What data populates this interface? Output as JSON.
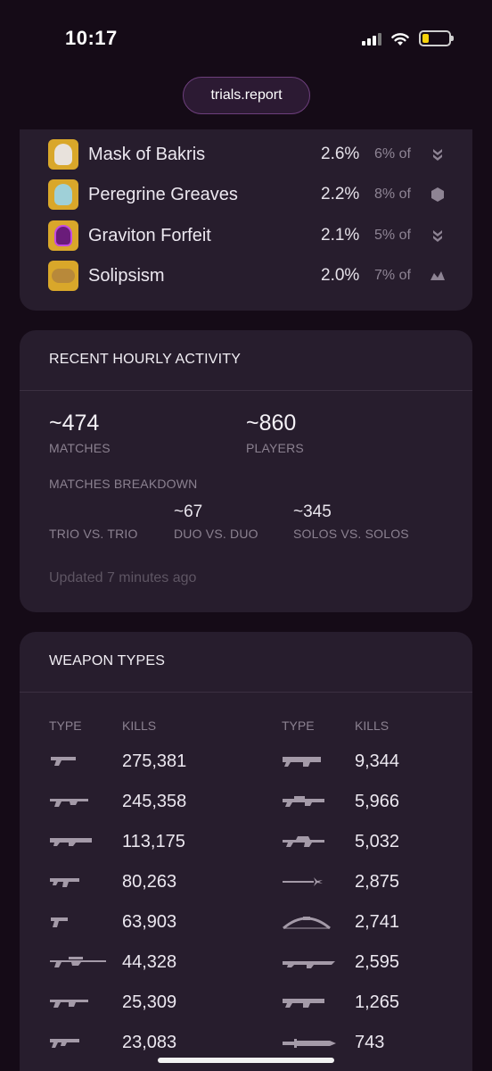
{
  "status_bar": {
    "time": "10:17"
  },
  "browser": {
    "url": "trials.report"
  },
  "armor": {
    "items": [
      {
        "name": "Mask of Bakris",
        "pct": "2.6%",
        "of": "6% of",
        "class_icon": "hunter-icon",
        "thumb_color": "#d9a72a"
      },
      {
        "name": "Peregrine Greaves",
        "pct": "2.2%",
        "of": "8% of",
        "class_icon": "titan-icon",
        "thumb_color": "#d9a72a"
      },
      {
        "name": "Graviton Forfeit",
        "pct": "2.1%",
        "of": "5% of",
        "class_icon": "hunter-icon",
        "thumb_color": "#d9a72a"
      },
      {
        "name": "Solipsism",
        "pct": "2.0%",
        "of": "7% of",
        "class_icon": "warlock-icon",
        "thumb_color": "#d9a72a"
      }
    ]
  },
  "activity": {
    "title": "RECENT HOURLY ACTIVITY",
    "matches": "~474",
    "matches_label": "MATCHES",
    "players": "~860",
    "players_label": "PLAYERS",
    "breakdown_label": "MATCHES BREAKDOWN",
    "trio_label": "TRIO VS. TRIO",
    "duo_value": "~67",
    "duo_label": "DUO VS. DUO",
    "solo_value": "~345",
    "solo_label": "SOLOS VS. SOLOS",
    "updated": "Updated 7 minutes ago"
  },
  "weapons": {
    "title": "WEAPON TYPES",
    "type_header": "TYPE",
    "kills_header": "KILLS",
    "left": [
      {
        "icon": "hand-cannon-icon",
        "kills": "275,381"
      },
      {
        "icon": "pulse-rifle-icon",
        "kills": "245,358"
      },
      {
        "icon": "scout-rifle-icon",
        "kills": "113,175"
      },
      {
        "icon": "submachine-gun-icon",
        "kills": "80,263"
      },
      {
        "icon": "sidearm-icon",
        "kills": "63,903"
      },
      {
        "icon": "sniper-rifle-icon",
        "kills": "44,328"
      },
      {
        "icon": "auto-rifle-icon",
        "kills": "25,309"
      },
      {
        "icon": "shotgun-icon",
        "kills": "23,083"
      }
    ],
    "right": [
      {
        "icon": "grenade-launcher-icon",
        "kills": "9,344"
      },
      {
        "icon": "fusion-rifle-icon",
        "kills": "5,966"
      },
      {
        "icon": "trace-rifle-icon",
        "kills": "5,032"
      },
      {
        "icon": "glaive-icon",
        "kills": "2,875"
      },
      {
        "icon": "bow-icon",
        "kills": "2,741"
      },
      {
        "icon": "linear-fusion-rifle-icon",
        "kills": "2,595"
      },
      {
        "icon": "machine-gun-icon",
        "kills": "1,265"
      },
      {
        "icon": "sword-icon",
        "kills": "743"
      }
    ]
  }
}
